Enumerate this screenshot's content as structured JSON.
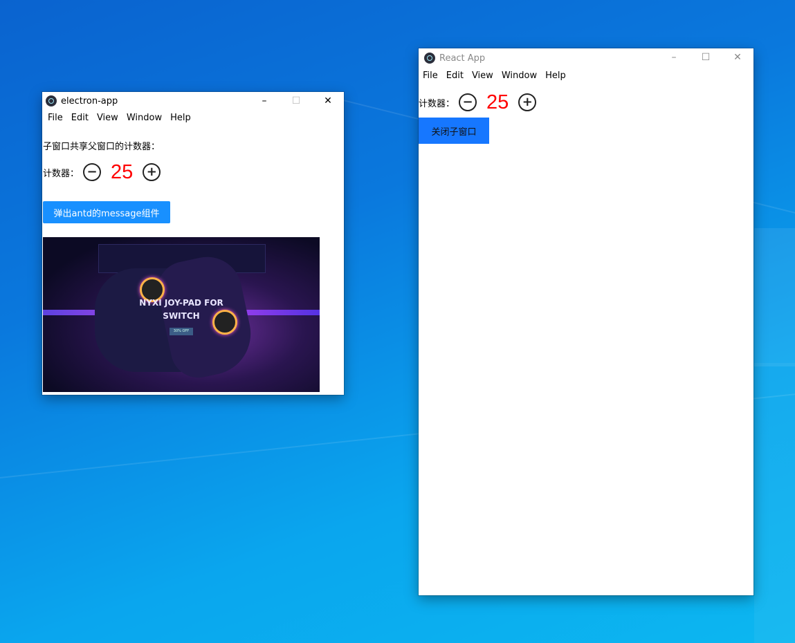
{
  "colors": {
    "accent_left": "#1890ff",
    "accent_right": "#1677ff",
    "count_color": "#ff0000"
  },
  "left_window": {
    "title": "electron-app",
    "controls": {
      "minimize": "–",
      "maximize": "☐",
      "close": "✕"
    },
    "menu": [
      "File",
      "Edit",
      "View",
      "Window",
      "Help"
    ],
    "heading": "子窗口共享父窗口的计数器：",
    "counter": {
      "label": "计数器：",
      "minus": "−",
      "value": "25",
      "plus": "+"
    },
    "button_label": "弹出antd的message组件",
    "banner": {
      "title_line1": "NYXI JOY-PAD FOR",
      "title_line2": "SWITCH",
      "tag": "30% OFF"
    }
  },
  "right_window": {
    "title": "React App",
    "controls": {
      "minimize": "–",
      "maximize": "☐",
      "close": "✕"
    },
    "menu": [
      "File",
      "Edit",
      "View",
      "Window",
      "Help"
    ],
    "counter": {
      "label": "计数器：",
      "minus": "−",
      "value": "25",
      "plus": "+"
    },
    "button_label": "关闭子窗口"
  }
}
